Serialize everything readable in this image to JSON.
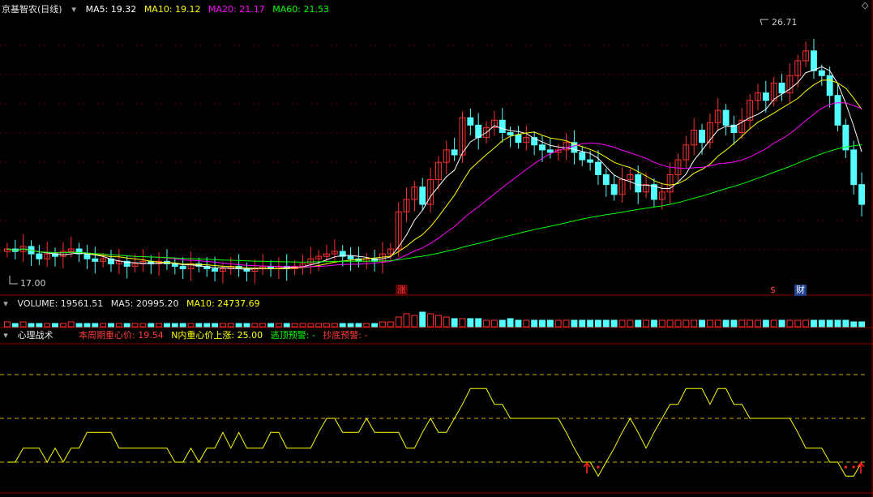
{
  "price_panel": {
    "stock_title": "京基智农(日线)",
    "ma_labels": [
      {
        "text": "MA5: 19.32",
        "color": "#ffffff"
      },
      {
        "text": "MA10: 19.12",
        "color": "#ffff00"
      },
      {
        "text": "MA20: 21.17",
        "color": "#ff00ff"
      },
      {
        "text": "MA60: 21.53",
        "color": "#00ff00"
      }
    ],
    "high_label": "26.71",
    "low_label": "17.00",
    "markers": [
      {
        "text": "涨",
        "color": "#ff4040",
        "bg": "#5a0000"
      },
      {
        "text": "$",
        "color": "#ff4040",
        "bg": "none"
      },
      {
        "text": "财",
        "color": "#ffffff",
        "bg": "#1f3f8f"
      }
    ]
  },
  "volume_panel": {
    "label": "VOLUME: 19561.51",
    "ma5": "MA5: 20995.20",
    "ma10": "MA10: 24737.69"
  },
  "indicator_panel": {
    "name": "心理战术",
    "v1": "本周期重心价: 19.54",
    "v2": "N内重心价上涨: 25.00",
    "v3": "逃顶预警: -",
    "v4": "抄底预警: -"
  },
  "colors": {
    "up": "#ff3030",
    "down": "#54ffff",
    "ma5": "#ffffff",
    "ma10": "#ffff00",
    "ma20": "#ff00ff",
    "ma60": "#00ff00",
    "psy": "#ffff00",
    "alert": "#ff2020"
  },
  "chart_data": [
    {
      "type": "candlestick",
      "title": "京基智农(日线)",
      "x_count": 108,
      "ylim": [
        16.2,
        27.4
      ],
      "close": [
        18.0,
        17.9,
        18.1,
        17.8,
        17.6,
        17.8,
        17.7,
        17.9,
        18.0,
        17.8,
        17.6,
        17.5,
        17.6,
        17.4,
        17.5,
        17.3,
        17.4,
        17.5,
        17.4,
        17.5,
        17.4,
        17.3,
        17.2,
        17.4,
        17.3,
        17.2,
        17.1,
        17.2,
        17.3,
        17.2,
        17.1,
        17.2,
        17.3,
        17.2,
        17.3,
        17.2,
        17.3,
        17.4,
        17.6,
        17.7,
        17.8,
        17.9,
        17.7,
        17.6,
        17.5,
        17.6,
        17.5,
        17.8,
        18.0,
        19.5,
        20.0,
        20.5,
        19.8,
        20.8,
        21.5,
        22.0,
        21.8,
        23.3,
        23.0,
        22.5,
        22.9,
        23.2,
        22.7,
        22.6,
        22.3,
        22.5,
        22.2,
        22.0,
        21.9,
        22.0,
        22.3,
        21.9,
        21.6,
        21.5,
        21.0,
        20.6,
        20.2,
        20.8,
        21.0,
        20.3,
        20.6,
        20.0,
        20.3,
        21.0,
        21.6,
        22.2,
        22.8,
        22.3,
        23.1,
        23.6,
        23.0,
        22.7,
        23.2,
        24.0,
        24.3,
        24.0,
        24.7,
        24.3,
        25.0,
        25.6,
        26.0,
        25.2,
        25.0,
        24.2,
        23.0,
        22.0,
        20.6,
        19.8
      ],
      "volume_ratio": [
        0.3,
        0.2,
        0.3,
        0.2,
        0.2,
        0.2,
        0.2,
        0.2,
        0.3,
        0.2,
        0.2,
        0.2,
        0.2,
        0.2,
        0.2,
        0.2,
        0.2,
        0.2,
        0.2,
        0.2,
        0.2,
        0.2,
        0.2,
        0.2,
        0.2,
        0.2,
        0.2,
        0.2,
        0.2,
        0.2,
        0.2,
        0.2,
        0.2,
        0.2,
        0.2,
        0.2,
        0.2,
        0.2,
        0.2,
        0.2,
        0.2,
        0.2,
        0.2,
        0.2,
        0.2,
        0.2,
        0.2,
        0.3,
        0.3,
        0.6,
        0.8,
        0.7,
        0.9,
        0.8,
        0.7,
        0.6,
        0.5,
        0.5,
        0.5,
        0.5,
        0.4,
        0.4,
        0.4,
        0.5,
        0.4,
        0.4,
        0.4,
        0.4,
        0.4,
        0.4,
        0.4,
        0.4,
        0.4,
        0.4,
        0.4,
        0.4,
        0.4,
        0.4,
        0.4,
        0.4,
        0.4,
        0.4,
        0.4,
        0.4,
        0.4,
        0.4,
        0.4,
        0.4,
        0.4,
        0.4,
        0.4,
        0.4,
        0.4,
        0.4,
        0.4,
        0.4,
        0.4,
        0.4,
        0.4,
        0.4,
        0.4,
        0.4,
        0.4,
        0.4,
        0.4,
        0.4,
        0.3,
        0.3
      ]
    },
    {
      "type": "line",
      "title": "心理战术",
      "ylim": [
        0,
        100
      ],
      "reference_lines": [
        25,
        50,
        75
      ],
      "values": [
        25,
        25,
        33,
        33,
        33,
        25,
        33,
        25,
        33,
        33,
        42,
        42,
        42,
        42,
        33,
        33,
        33,
        33,
        33,
        33,
        33,
        25,
        25,
        33,
        25,
        33,
        33,
        42,
        33,
        42,
        33,
        33,
        33,
        42,
        42,
        33,
        33,
        33,
        33,
        42,
        50,
        50,
        42,
        42,
        42,
        50,
        42,
        42,
        42,
        42,
        33,
        33,
        42,
        50,
        42,
        42,
        50,
        58,
        67,
        67,
        67,
        58,
        58,
        50,
        50,
        50,
        50,
        50,
        50,
        50,
        42,
        33,
        25,
        25,
        17,
        25,
        33,
        42,
        50,
        42,
        33,
        42,
        50,
        58,
        58,
        67,
        67,
        67,
        58,
        67,
        67,
        58,
        58,
        50,
        50,
        50,
        50,
        50,
        50,
        42,
        33,
        33,
        33,
        25,
        25,
        17,
        17,
        25
      ]
    }
  ]
}
